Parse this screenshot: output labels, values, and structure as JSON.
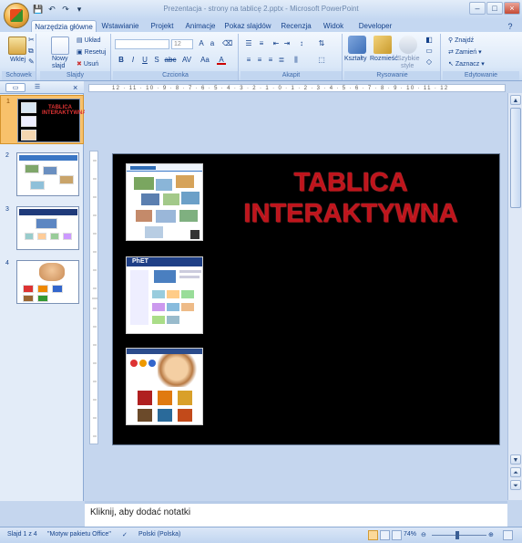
{
  "window": {
    "title": "Prezentacja - strony na tablicę 2.pptx - Microsoft PowerPoint"
  },
  "qat": {
    "save": "💾",
    "undo": "↶",
    "redo": "↷",
    "customize": "▾"
  },
  "tabs": [
    {
      "label": "Narzędzia główne",
      "active": true
    },
    {
      "label": "Wstawianie"
    },
    {
      "label": "Projekt"
    },
    {
      "label": "Animacje"
    },
    {
      "label": "Pokaz slajdów"
    },
    {
      "label": "Recenzja"
    },
    {
      "label": "Widok"
    },
    {
      "label": "Developer"
    }
  ],
  "ribbon": {
    "clipboard": {
      "label": "Schowek",
      "paste": "Wklej"
    },
    "slides": {
      "label": "Slajdy",
      "new_slide_1": "Nowy",
      "new_slide_2": "slajd",
      "layout": "Układ",
      "reset": "Resetuj",
      "delete": "Usuń"
    },
    "font": {
      "label": "Czcionka",
      "size": "12",
      "bold": "B",
      "italic": "I",
      "underline": "U",
      "strike": "S",
      "abc": "abc",
      "spacing": "AV",
      "case": "Aa",
      "color": "A"
    },
    "paragraph": {
      "label": "Akapit"
    },
    "drawing": {
      "label": "Rysowanie",
      "shapes": "Kształty",
      "arrange": "Rozmieść",
      "quick_styles_1": "Szybkie",
      "quick_styles_2": "style"
    },
    "editing": {
      "label": "Edytowanie",
      "find": "Znajdź",
      "replace": "Zamień",
      "select": "Zaznacz"
    }
  },
  "pane": {
    "tab_slides": "Slajdy",
    "tab_outline": "Konspekt",
    "close": "×"
  },
  "thumbnails": [
    {
      "num": "1",
      "title_line1": "TABLICA",
      "title_line2": "INTERAKTYWNA",
      "selected": true
    },
    {
      "num": "2"
    },
    {
      "num": "3"
    },
    {
      "num": "4"
    }
  ],
  "ruler": {
    "h_ticks": "12 · 11 · 10 · 9 · 8 · 7 · 6 · 5 · 4 · 3 · 2 · 1 · 0 · 1 · 2 · 3 · 4 · 5 · 6 · 7 · 8 · 9 · 10 · 11 · 12"
  },
  "slide": {
    "title_line1": "TABLICA",
    "title_line2": "INTERAKTYWNA",
    "phet_label": "PhET"
  },
  "notes": {
    "placeholder": "Kliknij, aby dodać notatki"
  },
  "status": {
    "slide_count": "Slajd 1 z 4",
    "theme": "\"Motyw pakietu Office\"",
    "language": "Polski (Polska)",
    "zoom": "74%"
  },
  "colors": {
    "title_red": "#c0141c",
    "ribbon_text": "#15428b",
    "selected_thumb": "#f8c16b"
  }
}
